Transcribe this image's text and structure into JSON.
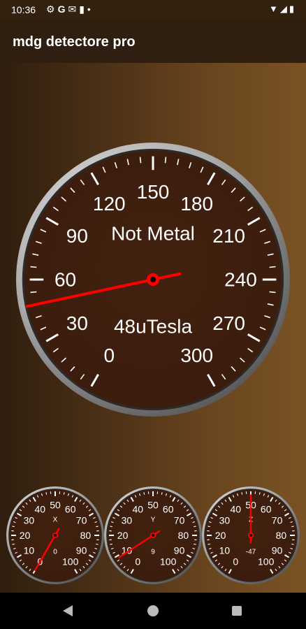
{
  "status_bar": {
    "time": "10:36",
    "icons": [
      "gear-icon",
      "google-icon",
      "mail-icon",
      "sim-card-icon",
      "dot-icon"
    ],
    "right_icons": [
      "wifi-icon",
      "cellular-icon",
      "battery-icon"
    ]
  },
  "app_bar": {
    "title": "mdg detectore pro"
  },
  "main_gauge": {
    "status_label": "Not Metal",
    "reading_label": "48uTesla",
    "tick_labels": [
      "0",
      "30",
      "60",
      "90",
      "120",
      "150",
      "180",
      "210",
      "240",
      "270",
      "300"
    ],
    "min": 0,
    "max": 300,
    "needle_value": 48,
    "needle_color": "#ff0000"
  },
  "small_gauges": [
    {
      "axis": "X",
      "value_label": "0",
      "needle_value": 0,
      "tick_labels": [
        "0",
        "10",
        "20",
        "30",
        "40",
        "50",
        "60",
        "70",
        "80",
        "90",
        "100"
      ]
    },
    {
      "axis": "Y",
      "value_label": "9",
      "needle_value": 9,
      "tick_labels": [
        "0",
        "10",
        "20",
        "30",
        "40",
        "50",
        "60",
        "70",
        "80",
        "90",
        "100"
      ]
    },
    {
      "axis": "Z",
      "value_label": "-47",
      "needle_value": 50,
      "tick_labels": [
        "0",
        "10",
        "20",
        "30",
        "40",
        "50",
        "60",
        "70",
        "80",
        "90",
        "100"
      ]
    }
  ],
  "colors": {
    "dial_face": "#3a1c0d",
    "bezel_light": "#e8e8e8",
    "bezel_dark": "#5a5a5a",
    "needle": "#ff0000"
  },
  "nav_bar": {
    "icons": [
      "back-icon",
      "home-icon",
      "recents-icon"
    ]
  }
}
